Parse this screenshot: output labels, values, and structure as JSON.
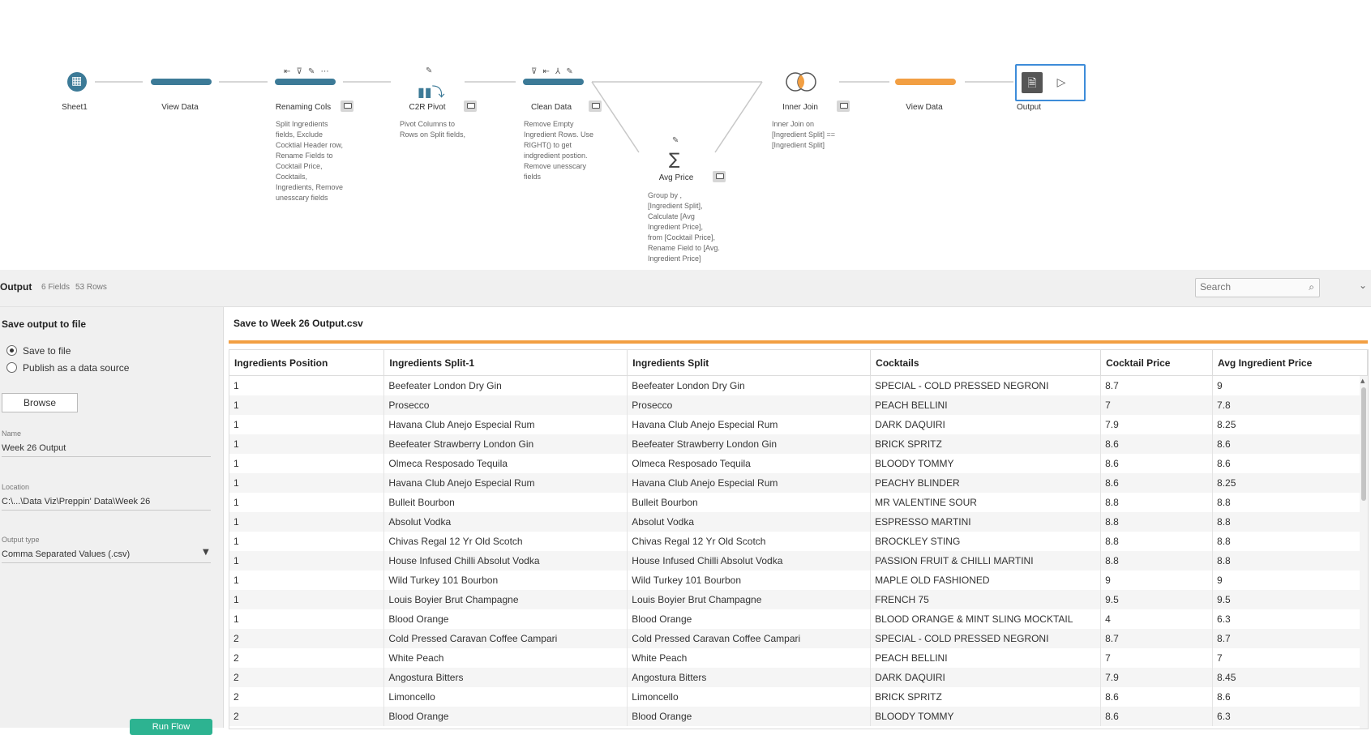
{
  "flow": {
    "nodes": {
      "sheet1": "Sheet1",
      "view_data_1": "View Data",
      "renaming_cols": "Renaming Cols",
      "c2r_pivot": "C2R Pivot",
      "clean_data": "Clean Data",
      "avg_price": "Avg Price",
      "inner_join": "Inner Join",
      "view_data_2": "View Data",
      "output": "Output"
    },
    "descriptions": {
      "renaming_cols": "Split Ingredients\nfields, Exclude\nCocktial Header row,\nRename Fields to\nCocktail Price,\nCocktails,\nIngredients, Remove\nunesscary fields",
      "c2r_pivot": "Pivot Columns to\nRows on Split fields,",
      "clean_data": "Remove Empty\nIngredient Rows. Use\nRIGHT() to get\nindgredient postion.\nRemove unesscary\nfields",
      "avg_price": "Group by ,\n[Ingredient Split],\nCalculate [Avg\nIngredient Price],\nfrom [Cocktail Price],\nRename Field to [Avg.\nIngredient Price]",
      "inner_join": "Inner Join on\n[Ingredient Split] ==\n[Ingredient Split]"
    },
    "colors": {
      "step_blue": "#3c7a97",
      "view_orange": "#f29f43",
      "selected_border": "#3d8cd9"
    }
  },
  "output_header": {
    "title": "Output",
    "fields": "6 Fields",
    "rows": "53 Rows",
    "search_placeholder": "Search"
  },
  "left_panel": {
    "title": "Save output to file",
    "radio_save": "Save to file",
    "radio_publish": "Publish as a data source",
    "browse": "Browse",
    "name_label": "Name",
    "name_value": "Week 26 Output",
    "location_label": "Location",
    "location_value": "C:\\...\\Data Viz\\Preppin' Data\\Week 26",
    "output_type_label": "Output type",
    "output_type_value": "Comma Separated Values (.csv)",
    "run_button": "Run Flow"
  },
  "right_panel": {
    "save_title": "Save to Week 26 Output.csv"
  },
  "table": {
    "columns": [
      "Ingredients Position",
      "Ingredients Split-1",
      "Ingredients Split",
      "Cocktails",
      "Cocktail Price",
      "Avg Ingredient Price"
    ],
    "rows": [
      [
        "1",
        "Beefeater London Dry Gin",
        "Beefeater London Dry Gin",
        "SPECIAL - COLD PRESSED NEGRONI",
        "8.7",
        "9"
      ],
      [
        "1",
        "Prosecco",
        "Prosecco",
        "PEACH BELLINI",
        "7",
        "7.8"
      ],
      [
        "1",
        "Havana Club Anejo Especial Rum",
        "Havana Club Anejo Especial Rum",
        "DARK DAQUIRI",
        "7.9",
        "8.25"
      ],
      [
        "1",
        "Beefeater Strawberry London Gin",
        "Beefeater Strawberry London Gin",
        "BRICK SPRITZ",
        "8.6",
        "8.6"
      ],
      [
        "1",
        "Olmeca Resposado Tequila",
        "Olmeca Resposado Tequila",
        "BLOODY TOMMY",
        "8.6",
        "8.6"
      ],
      [
        "1",
        "Havana Club Anejo Especial Rum",
        "Havana Club Anejo Especial Rum",
        "PEACHY BLINDER",
        "8.6",
        "8.25"
      ],
      [
        "1",
        "Bulleit Bourbon",
        "Bulleit Bourbon",
        "MR VALENTINE SOUR",
        "8.8",
        "8.8"
      ],
      [
        "1",
        "Absolut Vodka",
        "Absolut Vodka",
        "ESPRESSO MARTINI",
        "8.8",
        "8.8"
      ],
      [
        "1",
        "Chivas Regal 12 Yr Old Scotch",
        "Chivas Regal 12 Yr Old Scotch",
        "BROCKLEY STING",
        "8.8",
        "8.8"
      ],
      [
        "1",
        "House Infused Chilli Absolut Vodka",
        "House Infused Chilli Absolut Vodka",
        "PASSION FRUIT & CHILLI MARTINI",
        "8.8",
        "8.8"
      ],
      [
        "1",
        "Wild Turkey 101 Bourbon",
        "Wild Turkey 101 Bourbon",
        "MAPLE OLD FASHIONED",
        "9",
        "9"
      ],
      [
        "1",
        "Louis Boyier Brut Champagne",
        "Louis Boyier Brut Champagne",
        "FRENCH 75",
        "9.5",
        "9.5"
      ],
      [
        "1",
        "Blood Orange",
        "Blood Orange",
        "BLOOD ORANGE & MINT SLING MOCKTAIL",
        "4",
        "6.3"
      ],
      [
        "2",
        "Cold Pressed Caravan Coffee Campari",
        "Cold Pressed Caravan Coffee Campari",
        "SPECIAL - COLD PRESSED NEGRONI",
        "8.7",
        "8.7"
      ],
      [
        "2",
        "White Peach",
        "White Peach",
        "PEACH BELLINI",
        "7",
        "7"
      ],
      [
        "2",
        "Angostura Bitters",
        "Angostura Bitters",
        "DARK DAQUIRI",
        "7.9",
        "8.45"
      ],
      [
        "2",
        "Limoncello",
        "Limoncello",
        "BRICK SPRITZ",
        "8.6",
        "8.6"
      ],
      [
        "2",
        "Blood Orange",
        "Blood Orange",
        "BLOODY TOMMY",
        "8.6",
        "6.3"
      ]
    ]
  }
}
